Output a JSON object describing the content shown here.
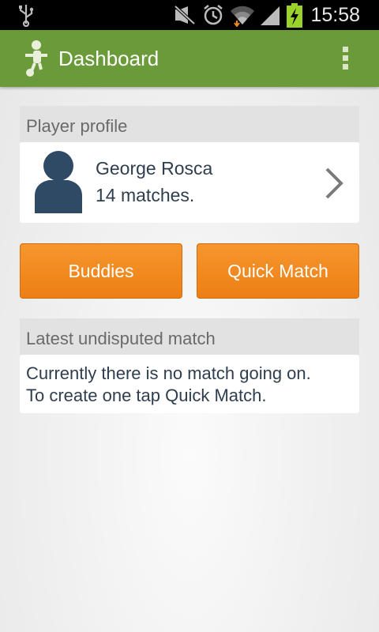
{
  "status_bar": {
    "time": "15:58",
    "icons": [
      "usb-icon",
      "mute-icon",
      "alarm-icon",
      "wifi-icon",
      "signal-icon",
      "battery-charging-icon"
    ]
  },
  "action_bar": {
    "title": "Dashboard",
    "app_icon": "foosball-player-icon",
    "overflow_icon": "overflow-menu-icon",
    "color": "#6b9a3a"
  },
  "player_profile": {
    "header": "Player profile",
    "name": "George Rosca",
    "matches": "14 matches.",
    "avatar_icon": "person-avatar-icon"
  },
  "buttons": {
    "buddies": "Buddies",
    "quick_match": "Quick Match",
    "color": "#f08a1f"
  },
  "latest_match": {
    "header": "Latest undisputed match",
    "line1": "Currently there is no match going on.",
    "line2": "To create one tap Quick Match."
  }
}
